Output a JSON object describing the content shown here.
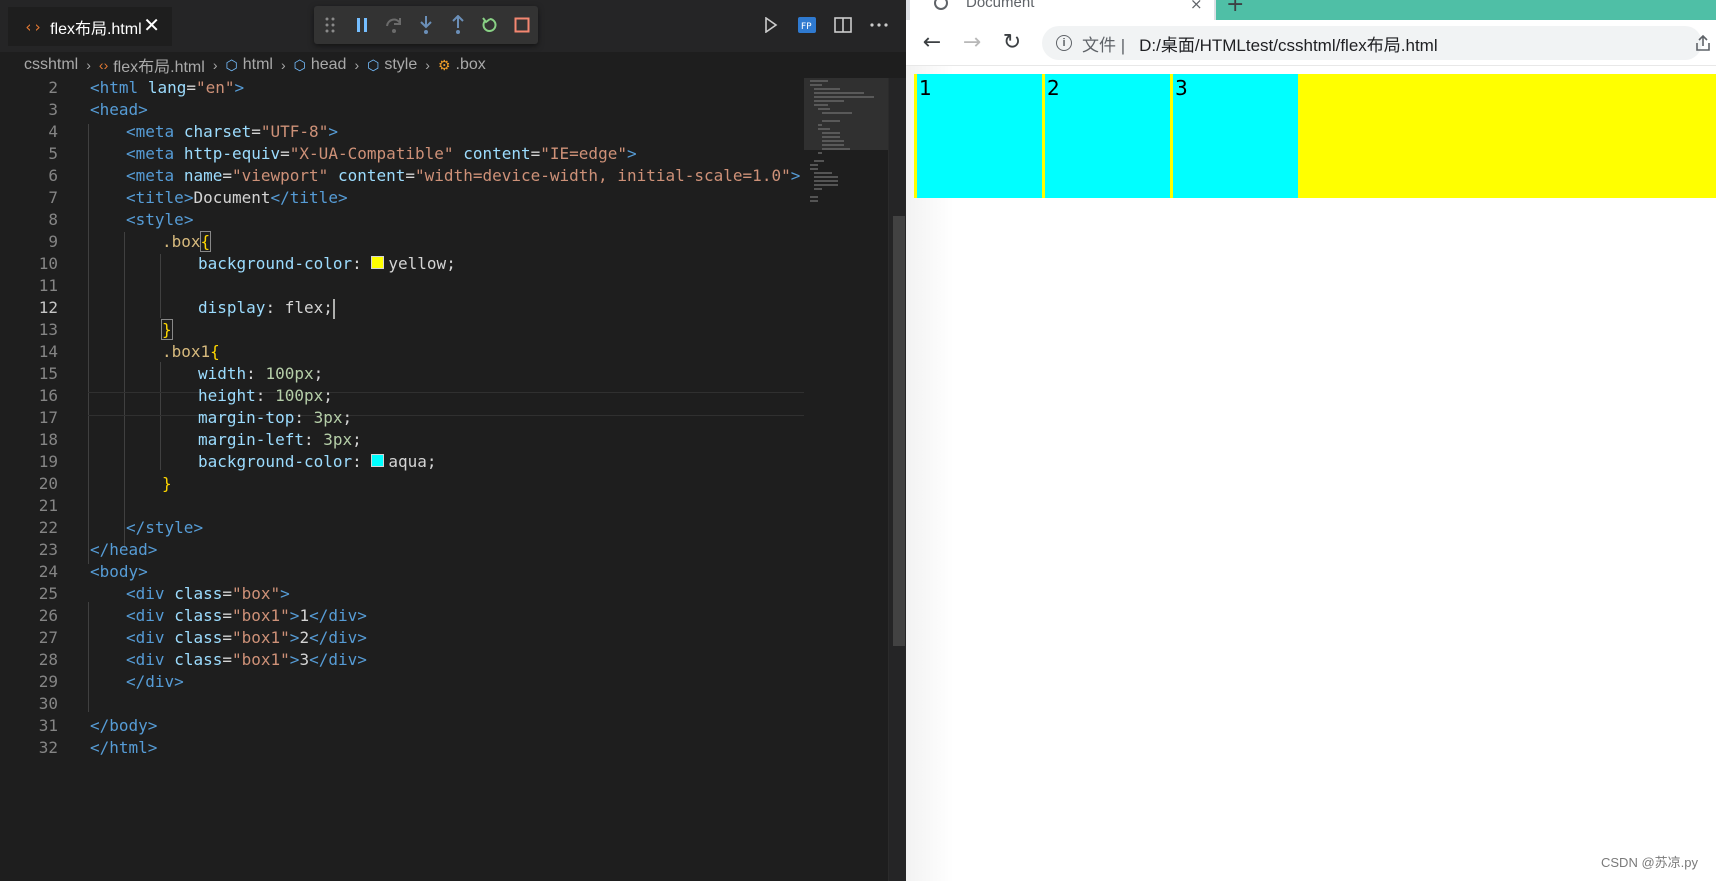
{
  "editor": {
    "tab": {
      "title": "flex布局.html",
      "close_glyph": "✕"
    },
    "breadcrumb": [
      {
        "label": "csshtml",
        "icon": ""
      },
      {
        "label": "flex布局.html",
        "icon": "html-file-icon"
      },
      {
        "label": "html",
        "icon": "symbol-element-icon"
      },
      {
        "label": "head",
        "icon": "symbol-element-icon"
      },
      {
        "label": "style",
        "icon": "symbol-element-icon"
      },
      {
        "label": ".box",
        "icon": "symbol-class-icon"
      }
    ],
    "debug_toolbar": [
      "drag-handle-icon",
      "pause-icon",
      "step-over-icon",
      "step-into-icon",
      "step-out-icon",
      "restart-icon",
      "stop-icon"
    ],
    "actions": [
      "run-icon",
      "go-live-icon",
      "split-editor-icon",
      "more-actions-icon"
    ],
    "current_line": 12,
    "lines": [
      {
        "n": "2"
      },
      {
        "n": "3"
      },
      {
        "n": "4"
      },
      {
        "n": "5"
      },
      {
        "n": "6"
      },
      {
        "n": "7"
      },
      {
        "n": "8"
      },
      {
        "n": "9"
      },
      {
        "n": "10"
      },
      {
        "n": "11"
      },
      {
        "n": "12"
      },
      {
        "n": "13"
      },
      {
        "n": "14"
      },
      {
        "n": "15"
      },
      {
        "n": "16"
      },
      {
        "n": "17"
      },
      {
        "n": "18"
      },
      {
        "n": "19"
      },
      {
        "n": "20"
      },
      {
        "n": "21"
      },
      {
        "n": "22"
      },
      {
        "n": "23"
      },
      {
        "n": "24"
      },
      {
        "n": "25"
      },
      {
        "n": "26"
      },
      {
        "n": "27"
      },
      {
        "n": "28"
      },
      {
        "n": "29"
      },
      {
        "n": "30"
      },
      {
        "n": "31"
      },
      {
        "n": "32"
      }
    ],
    "code": {
      "l2": {
        "lt": "<",
        "tag": "html",
        "attr": "lang",
        "eq": "=",
        "val": "\"en\"",
        "gt": ">"
      },
      "l3": {
        "lt": "<",
        "tag": "head",
        "gt": ">"
      },
      "l4": {
        "tag": "meta",
        "attr": "charset",
        "val": "\"UTF-8\""
      },
      "l5": {
        "tag": "meta",
        "attr1": "http-equiv",
        "val1": "\"X-UA-Compatible\"",
        "attr2": "content",
        "val2": "\"IE=edge\""
      },
      "l6": {
        "tag": "meta",
        "attr1": "name",
        "val1": "\"viewport\"",
        "attr2": "content",
        "val2": "\"width=device-width, initial-scale=1.0\""
      },
      "l7": {
        "tag": "title",
        "text": "Document",
        "close": "title"
      },
      "l8": {
        "tag": "style"
      },
      "l9": {
        "selector": ".box",
        "brace": "{"
      },
      "l10": {
        "prop": "background-color",
        "value": "yellow;",
        "swatch": "#ffff00"
      },
      "l12": {
        "prop": "display",
        "value": "flex;"
      },
      "l13": {
        "brace": "}"
      },
      "l14": {
        "selector": ".box1",
        "brace": "{"
      },
      "l15": {
        "prop": "width",
        "value": "100px",
        "semi": ";"
      },
      "l16": {
        "prop": "height",
        "value": "100px",
        "semi": ";"
      },
      "l17": {
        "prop": "margin-top",
        "value": "3px",
        "semi": ";"
      },
      "l18": {
        "prop": "margin-left",
        "value": "3px",
        "semi": ";"
      },
      "l19": {
        "prop": "background-color",
        "value": "aqua;",
        "swatch": "#00ffff"
      },
      "l20": {
        "brace": "}"
      },
      "l22": {
        "close": "style"
      },
      "l23": {
        "close": "head"
      },
      "l24": {
        "tag": "body"
      },
      "l25": {
        "tag": "div",
        "attr": "class",
        "val": "\"box\""
      },
      "l26": {
        "tag": "div",
        "attr": "class",
        "val": "\"box1\"",
        "text": "1"
      },
      "l27": {
        "tag": "div",
        "attr": "class",
        "val": "\"box1\"",
        "text": "2"
      },
      "l28": {
        "tag": "div",
        "attr": "class",
        "val": "\"box1\"",
        "text": "3"
      },
      "l29": {
        "close": "div"
      },
      "l31": {
        "close": "body"
      },
      "l32": {
        "close": "html"
      }
    }
  },
  "browser": {
    "tab_title": "Document",
    "tab_close": "×",
    "new_tab": "+",
    "nav": {
      "back": "←",
      "forward": "→",
      "reload": "↻"
    },
    "omnibox": {
      "info": "i",
      "chip": "文件 |",
      "url": "D:/桌面/HTMLtest/csshtml/flex布局.html"
    },
    "page": {
      "container_color": "#ffff00",
      "item_color": "#00ffff",
      "items": [
        "1",
        "2",
        "3"
      ]
    },
    "watermark": "CSDN @苏凉.py"
  },
  "colors": {
    "editor_bg": "#1e1e1e",
    "tag": "#569cd6",
    "attr": "#9cdcfe",
    "string": "#ce9178",
    "selector": "#d7ba7d",
    "number": "#b5cea8",
    "bracket": "#ffd700",
    "accent_teal": "#4fbfa6"
  }
}
